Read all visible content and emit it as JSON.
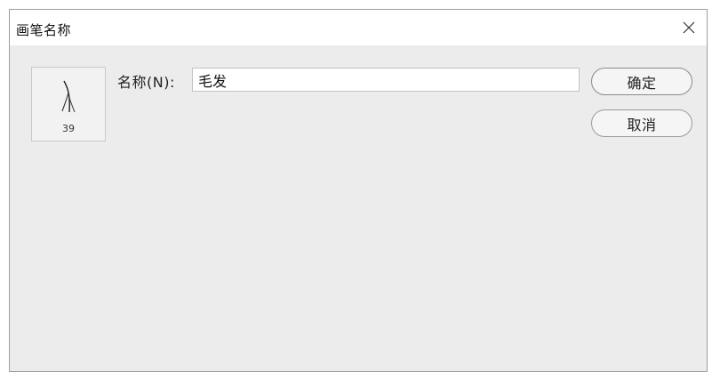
{
  "window": {
    "title": "画笔名称",
    "close_icon": "close-icon"
  },
  "preview": {
    "icon": "hair-brush-stroke-icon",
    "size": "39"
  },
  "form": {
    "name_label": "名称(N):",
    "name_value": "毛发"
  },
  "buttons": {
    "ok_label": "确定",
    "cancel_label": "取消"
  }
}
